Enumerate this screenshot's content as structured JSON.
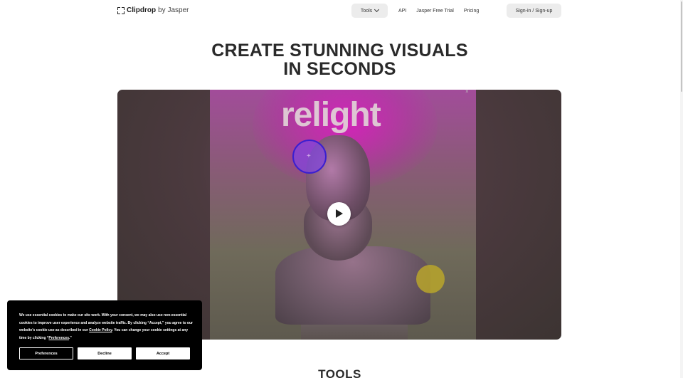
{
  "header": {
    "logo_brand": "Clipdrop",
    "logo_by": "by Jasper",
    "nav": {
      "tools_label": "Tools",
      "api_label": "API",
      "jasper_trial_label": "Jasper Free Trial",
      "pricing_label": "Pricing",
      "signin_label": "Sign-in / Sign-up"
    }
  },
  "hero": {
    "title_line1": "CREATE STUNNING VISUALS",
    "title_line2": "IN SECONDS"
  },
  "video": {
    "overlay_text": "relight",
    "close_glyph": "×",
    "light_cross_glyph": "+"
  },
  "tools": {
    "heading": "TOOLS"
  },
  "cookie": {
    "text_part1": "We use essential cookies to make our site work. With your consent, we may also use non-essential cookies to improve user experience and analyze website traffic. By clicking “Accept,” you agree to our website's cookie use as described in our ",
    "policy_link": "Cookie Policy",
    "text_part2": ". You can change your cookie settings at any time by clicking “",
    "preferences_link": "Preferences",
    "text_part3": ".”",
    "preferences_button": "Preferences",
    "decline_button": "Decline",
    "accept_button": "Accept"
  },
  "colors": {
    "nav_pill_bg": "#ececec",
    "cookie_bg": "#000000",
    "light_purple": "#3a1fd0",
    "light_yellow": "#beaa28"
  }
}
